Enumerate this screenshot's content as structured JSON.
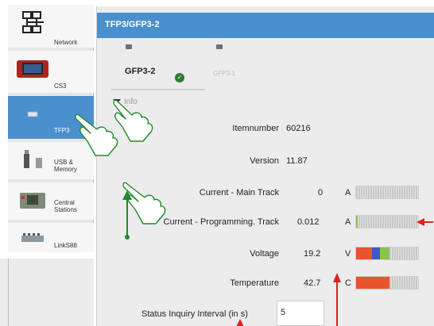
{
  "sidebar": {
    "items": [
      {
        "label": "Network",
        "icon": "network-icon"
      },
      {
        "label": "CS3",
        "icon": "cs3-device-icon"
      },
      {
        "label": "TFP3",
        "icon": "tfp3-device-icon"
      },
      {
        "label": "USB &\nMemory",
        "icon": "usb-memory-icon"
      },
      {
        "label": "Central\nStations",
        "icon": "central-station-icon"
      },
      {
        "label": "LinkS88",
        "icon": "links88-icon"
      }
    ]
  },
  "panel": {
    "title": "TFP3/GFP3-2",
    "tabs": [
      {
        "label": "GFP3-2",
        "active": true
      },
      {
        "label": "GFP3-1",
        "active": false
      }
    ],
    "section": "Info"
  },
  "info_rows": [
    {
      "label": "Itemnumber",
      "value": "60216",
      "unit": ""
    },
    {
      "label": "Version",
      "value": "11.87",
      "unit": ""
    },
    {
      "label": "Current - Main Track",
      "value": "0",
      "unit": "A"
    },
    {
      "label": "Current - Programming. Track",
      "value": "0.012",
      "unit": "A"
    },
    {
      "label": "Voltage",
      "value": "19.2",
      "unit": "V"
    },
    {
      "label": "Temperature",
      "value": "42.7",
      "unit": "C"
    }
  ],
  "gauges": {
    "main_track_fraction": 0.0,
    "prog_track_fraction": 0.02,
    "voltage_colors": [
      "#e8542c",
      "#3b5bc4",
      "#8bc34a"
    ],
    "temperature_color": "#e8542c"
  },
  "status_interval": {
    "label": "Status Inquiry Interval (in s)",
    "value": "5"
  },
  "colors": {
    "accent": "#4a90cf",
    "annotation_green": "#1f8a2c",
    "annotation_red": "#e02020",
    "bar_orange": "#e8542c"
  }
}
